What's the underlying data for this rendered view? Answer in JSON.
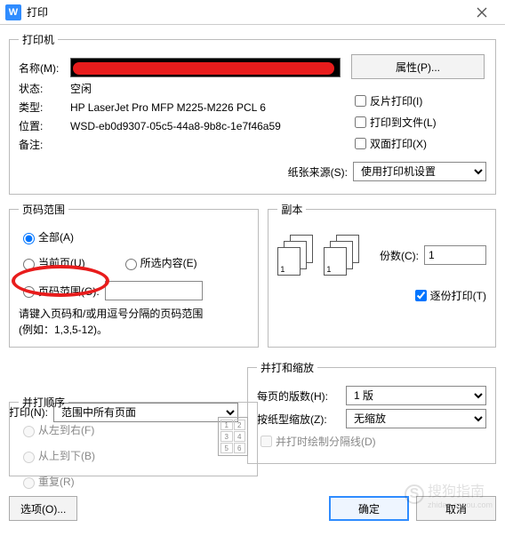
{
  "titlebar": {
    "app_glyph": "W",
    "title": "打印"
  },
  "printer": {
    "legend": "打印机",
    "name_label": "名称(M):",
    "properties_btn": "属性(P)...",
    "status_label": "状态:",
    "status_value": "空闲",
    "type_label": "类型:",
    "type_value": "HP LaserJet Pro MFP M225-M226 PCL 6",
    "location_label": "位置:",
    "location_value": "WSD-eb0d9307-05c5-44a8-9b8c-1e7f46a59",
    "comment_label": "备注:",
    "mirror_cb": "反片打印(I)",
    "tofile_cb": "打印到文件(L)",
    "duplex_cb": "双面打印(X)",
    "source_label": "纸张来源(S):",
    "source_value": "使用打印机设置"
  },
  "range": {
    "legend": "页码范围",
    "all": "全部(A)",
    "current": "当前页(U)",
    "selection": "所选内容(E)",
    "pages": "页码范围(G):",
    "help1": "请键入页码和/或用逗号分隔的页码范围",
    "help2": "(例如：1,3,5-12)。"
  },
  "copies": {
    "legend": "副本",
    "count_label": "份数(C):",
    "count_value": "1",
    "collate": "逐份打印(T)"
  },
  "print_what": {
    "label": "打印(N):",
    "value": "范围中所有页面"
  },
  "order": {
    "legend": "并打顺序",
    "lr": "从左到右(F)",
    "tb": "从上到下(B)",
    "repeat": "重复(R)"
  },
  "scale": {
    "legend": "并打和缩放",
    "perpage_label": "每页的版数(H):",
    "perpage_value": "1 版",
    "scale_label": "按纸型缩放(Z):",
    "scale_value": "无缩放",
    "sep_cb": "并打时绘制分隔线(D)"
  },
  "buttons": {
    "options": "选项(O)...",
    "ok": "确定",
    "cancel": "取消"
  },
  "watermark": {
    "brand": "搜狗指南",
    "sub": "zhidao.sogou.com"
  }
}
